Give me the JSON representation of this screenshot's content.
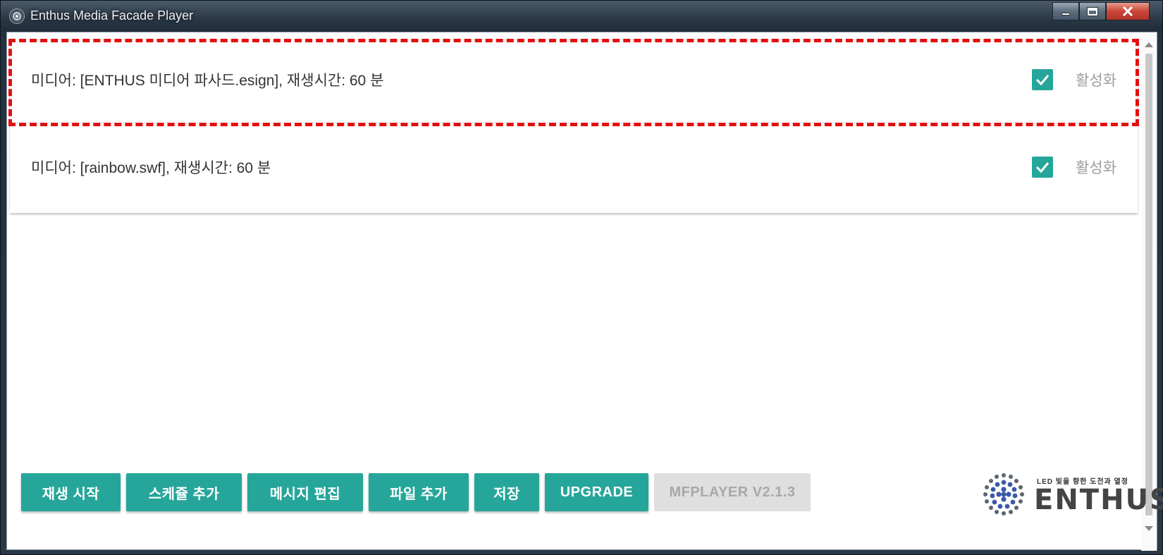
{
  "window": {
    "title": "Enthus Media Facade Player",
    "accent_color": "#26a69a"
  },
  "schedule": {
    "items": [
      {
        "text": "미디어: [ENTHUS 미디어 파사드.esign], 재생시간: 60 분",
        "checked": true,
        "label": "활성화"
      },
      {
        "text": "미디어: [rainbow.swf], 재생시간: 60 분",
        "checked": true,
        "label": "활성화"
      }
    ]
  },
  "toolbar": {
    "play_start": "재생 시작",
    "add_schedule": "스케쥴 추가",
    "edit_message": "메시지 편집",
    "add_file": "파일 추가",
    "save": "저장",
    "upgrade": "UPGRADE",
    "version": "MFPLAYER V2.1.3"
  },
  "logo": {
    "tagline": "LED 빛을 향한 도전과 열정",
    "word": "ENTHUS"
  }
}
